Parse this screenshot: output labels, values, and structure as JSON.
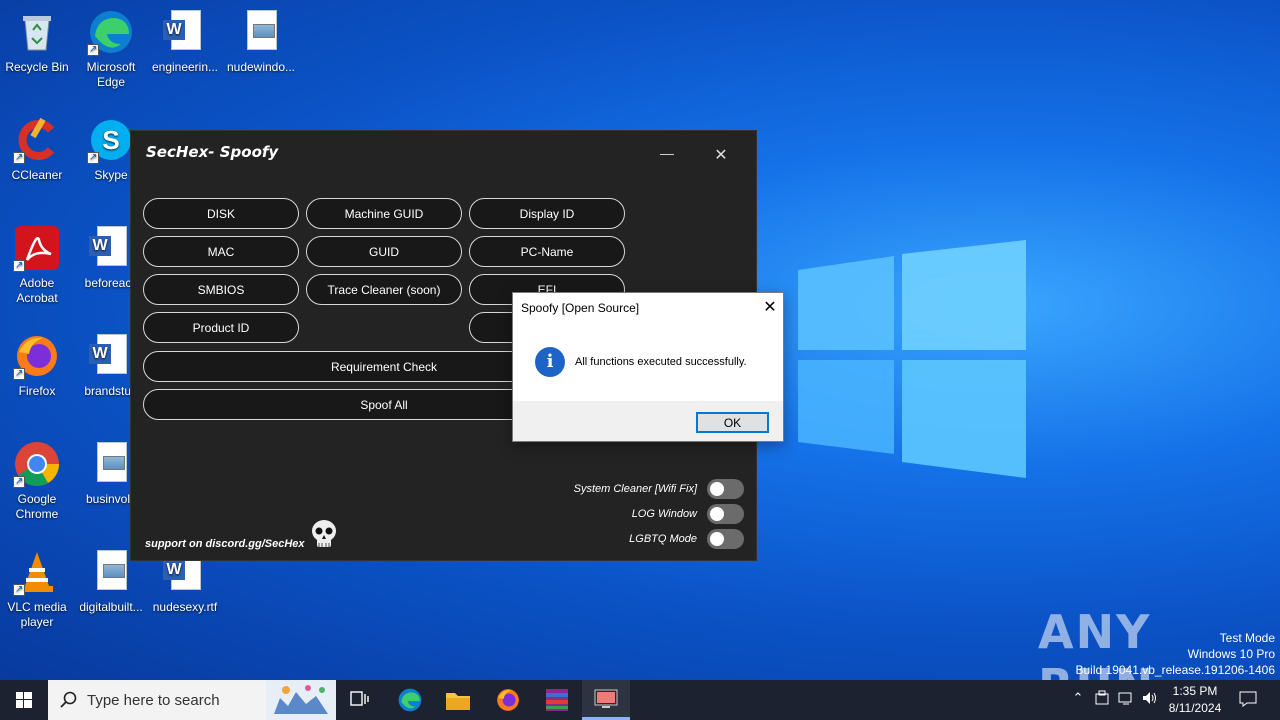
{
  "desktop": {
    "icons": [
      {
        "label": "Recycle Bin"
      },
      {
        "label": "Microsoft Edge"
      },
      {
        "label": "engineerin..."
      },
      {
        "label": "nudewindo..."
      },
      {
        "label": "CCleaner"
      },
      {
        "label": "Skype"
      },
      {
        "label": "Adobe Acrobat"
      },
      {
        "label": "beforeacc"
      },
      {
        "label": "Firefox"
      },
      {
        "label": "brandstud"
      },
      {
        "label": "Google Chrome"
      },
      {
        "label": "businvolv"
      },
      {
        "label": "VLC media player"
      },
      {
        "label": "digitalbuilt..."
      },
      {
        "label": "nudesexy.rtf"
      }
    ]
  },
  "app": {
    "title": "SecHex- Spoofy",
    "minimize_glyph": "—",
    "close_glyph": "✕",
    "buttons": {
      "disk": "DISK",
      "machine_guid": "Machine GUID",
      "display_id": "Display ID",
      "mac": "MAC",
      "guid": "GUID",
      "pc_name": "PC-Name",
      "smbios": "SMBIOS",
      "trace_cleaner": "Trace Cleaner (soon)",
      "efi": "EFI",
      "product_id": "Product ID",
      "requirement_check": "Requirement Check",
      "spoof_all": "Spoof All"
    },
    "toggles": {
      "system_cleaner": "System Cleaner [Wifi Fix]",
      "log_window": "LOG Window",
      "lgbtq_mode": "LGBTQ Mode"
    },
    "support_text": "support on discord.gg/SecHex"
  },
  "msgbox": {
    "title": "Spoofy [Open Source]",
    "close_glyph": "✕",
    "message": "All functions executed successfully.",
    "info_glyph": "i",
    "ok_label": "OK"
  },
  "watermark": {
    "brand": "ANY RUN",
    "test_mode": "Test Mode",
    "os": "Windows 10 Pro",
    "build": "Build 19041.vb_release.191206-1406"
  },
  "taskbar": {
    "search_placeholder": "Type here to search",
    "time": "1:35 PM",
    "date": "8/11/2024"
  },
  "colors": {
    "wallpaper": "#0b53c7",
    "app_bg": "#232323",
    "taskbar": "#1c2230",
    "accent": "#0078d7"
  }
}
